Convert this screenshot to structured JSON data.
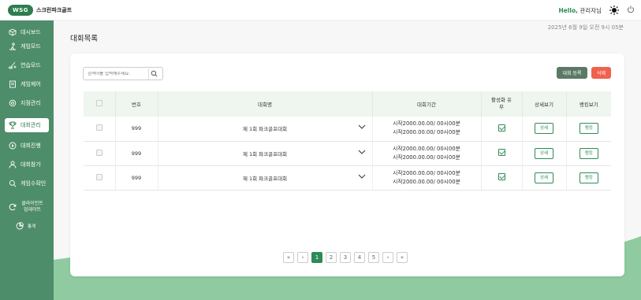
{
  "header": {
    "logo_badge": "WSG",
    "logo_text": "스크린파크골프",
    "hello_prefix": "Hello,",
    "user": "관리자님"
  },
  "sidebar": {
    "items": [
      {
        "label": "대시보드",
        "icon": "cube-icon"
      },
      {
        "label": "게임모드",
        "icon": "golfer-icon"
      },
      {
        "label": "연습모드",
        "icon": "club-icon"
      },
      {
        "label": "게임제어",
        "icon": "document-icon"
      },
      {
        "label": "지점관리",
        "icon": "settings-icon"
      },
      {
        "label": "대회관리",
        "icon": "trophy-icon",
        "active": true
      },
      {
        "label": "대회진행",
        "icon": "play-icon"
      },
      {
        "label": "대회참가",
        "icon": "user-icon"
      },
      {
        "label": "게임수확인",
        "icon": "search-icon"
      },
      {
        "label": "클라이언트 업데이트",
        "icon": "refresh-icon"
      },
      {
        "label": "통계",
        "icon": "chart-icon"
      }
    ]
  },
  "main": {
    "title": "대회목록",
    "datetime": "2025년 6월 9일 오전 9시 05분",
    "search_placeholder": "검색어를 입력해주세요.",
    "btn_register": "대회 등록",
    "btn_delete": "삭제"
  },
  "table": {
    "headers": [
      "번호",
      "대회명",
      "대회기간",
      "활성화 유무",
      "상세보기",
      "랭킹보기"
    ],
    "rows": [
      {
        "no": "999",
        "name": "제 1회 파크골프대회",
        "start": "시작2000.00.00/ 00시00분",
        "end": "시작2000.00.00/ 00시00분",
        "active": true,
        "detail": "상세",
        "ranking": "랭킹"
      },
      {
        "no": "999",
        "name": "제 1회 파크골프대회",
        "start": "시작2000.00.00/ 00시00분",
        "end": "시작2000.00.00/ 00시00분",
        "active": true,
        "detail": "상세",
        "ranking": "랭킹"
      },
      {
        "no": "999",
        "name": "제 1회 파크골프대회",
        "start": "시작2000.00.00/ 00시00분",
        "end": "시작2000.00.00/ 00시00분",
        "active": true,
        "detail": "상세",
        "ranking": "랭킹"
      }
    ]
  },
  "pagination": {
    "first": "«",
    "prev": "‹",
    "pages": [
      "1",
      "2",
      "3",
      "4",
      "5"
    ],
    "current": "1",
    "next": "›",
    "last": "»"
  },
  "colors": {
    "sidebar": "#4e8d69",
    "accent": "#2e8b57",
    "delete": "#f0614e",
    "register": "#5b7a66",
    "table_header": "#eef6ef"
  }
}
